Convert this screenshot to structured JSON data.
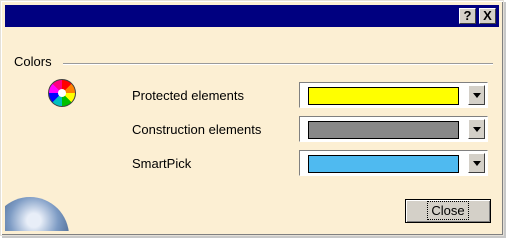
{
  "window": {
    "title": "",
    "help_button": "?",
    "close_button": "X"
  },
  "group": {
    "label": "Colors"
  },
  "rows": [
    {
      "label": "Protected elements",
      "color": "#ffff00"
    },
    {
      "label": "Construction elements",
      "color": "#888888"
    },
    {
      "label": "SmartPick",
      "color": "#4fbaf0"
    }
  ],
  "buttons": {
    "close": "Close"
  },
  "icons": {
    "group_icon": "color-wheel-icon",
    "decoration": "globe-icon"
  }
}
